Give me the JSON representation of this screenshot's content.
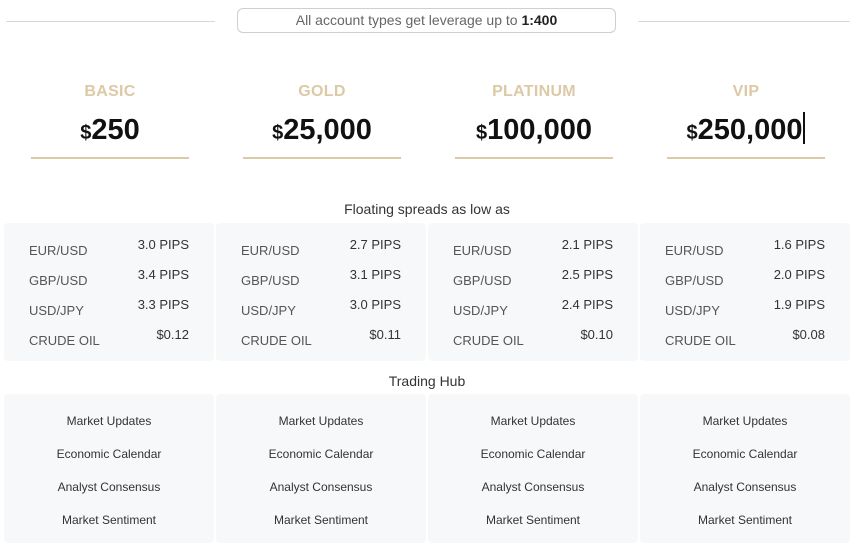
{
  "banner": {
    "text": "All account types get leverage up to",
    "value": "1:400"
  },
  "currency_symbol": "$",
  "plans": [
    {
      "name": "BASIC",
      "price": "250"
    },
    {
      "name": "GOLD",
      "price": "25,000"
    },
    {
      "name": "PLATINUM",
      "price": "100,000"
    },
    {
      "name": "VIP",
      "price": "250,000"
    }
  ],
  "spreads": {
    "title": "Floating spreads as low as",
    "rows": [
      "EUR/USD",
      "GBP/USD",
      "USD/JPY",
      "CRUDE OIL"
    ],
    "values": [
      [
        "3.0 PIPS",
        "3.4 PIPS",
        "3.3 PIPS",
        "$0.12"
      ],
      [
        "2.7 PIPS",
        "3.1 PIPS",
        "3.0 PIPS",
        "$0.11"
      ],
      [
        "2.1 PIPS",
        "2.5 PIPS",
        "2.4 PIPS",
        "$0.10"
      ],
      [
        "1.6 PIPS",
        "2.0 PIPS",
        "1.9 PIPS",
        "$0.08"
      ]
    ]
  },
  "hub": {
    "title": "Trading Hub",
    "items": [
      "Market Updates",
      "Economic Calendar",
      "Analyst Consensus",
      "Market Sentiment"
    ]
  },
  "colors": {
    "accent_gold": "#dcc9a6",
    "card_bg": "#f7f8f9"
  }
}
